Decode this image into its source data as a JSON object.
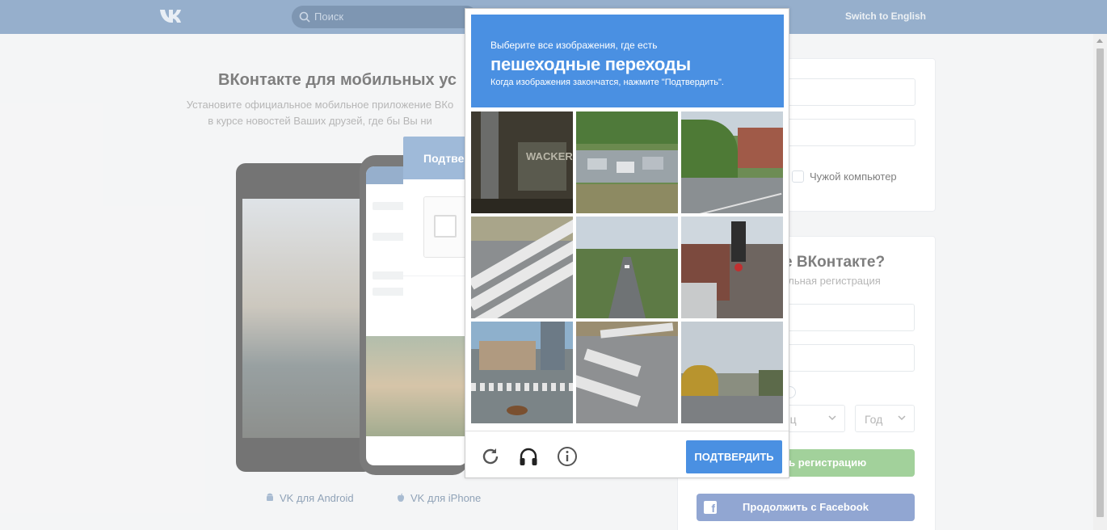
{
  "header": {
    "search_placeholder": "Поиск",
    "switch_language": "Switch to English",
    "logo": "vk-logo"
  },
  "promo": {
    "title": "ВКонтакте для мобильных ус",
    "subtitle_line1": "Установите официальное мобильное приложение ВКо",
    "subtitle_line2": "в курсе новостей Ваших друзей, где бы Вы ни",
    "android_link": "VK для Android",
    "iphone_link": "VK для iPhone"
  },
  "login": {
    "foreign_computer_label": "Чужой компьютер"
  },
  "register": {
    "title": "е ВКонтакте?",
    "subtitle": "альная регистрация",
    "month_placeholder": "сяц",
    "year_placeholder": "Год",
    "submit_label": "ть регистрацию",
    "facebook_label": "Продолжить с Facebook"
  },
  "confirm_dialog": {
    "title": "Подтверд"
  },
  "captcha": {
    "instruction": "Выберите все изображения, где есть",
    "target": "пешеходные переходы",
    "hint": "Когда изображения закончатся, нажмите \"Подтвердить\".",
    "verify_label": "ПОДТВЕРДИТЬ",
    "tile_overlay_text": "WACKER",
    "tiles": [
      "tile-1",
      "tile-2",
      "tile-3",
      "tile-4",
      "tile-5",
      "tile-6",
      "tile-7",
      "tile-8",
      "tile-9"
    ]
  },
  "colors": {
    "header": "#4a76a8",
    "captcha_accent": "#4a90e2",
    "register_green": "#5fb053",
    "facebook_blue": "#4267b2"
  }
}
